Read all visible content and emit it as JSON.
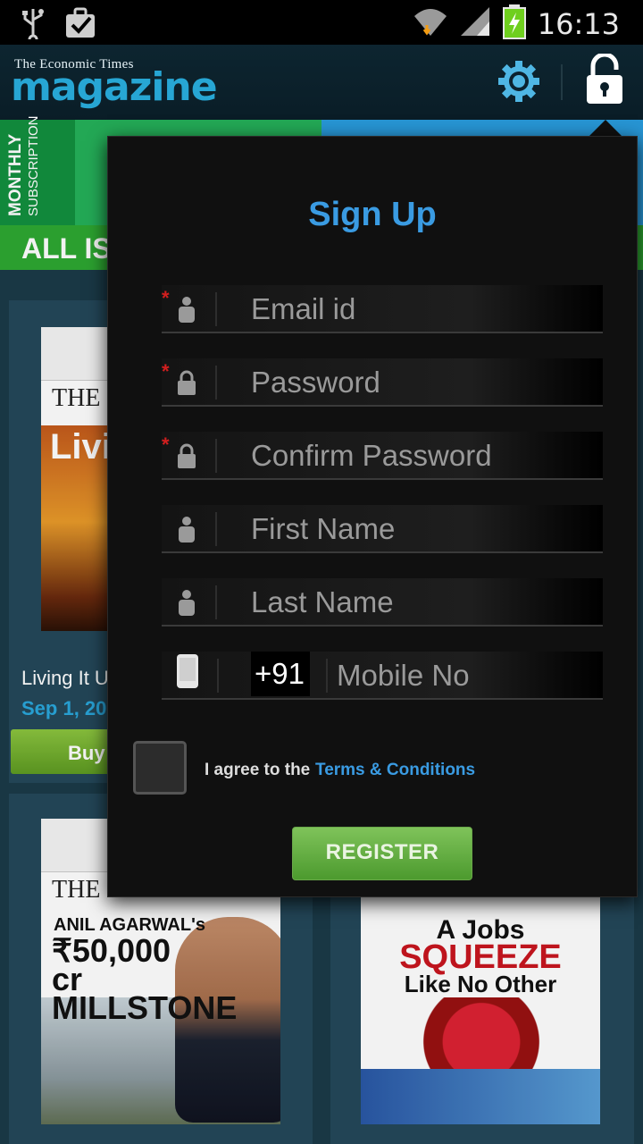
{
  "status_bar": {
    "time": "16:13",
    "icons": [
      "usb-icon",
      "checkbox-icon",
      "wifi-icon",
      "signal-icon",
      "battery-icon"
    ]
  },
  "header": {
    "logo_top": "The Economic Times",
    "logo_main": "magazine",
    "settings_icon": "gear-icon",
    "account_icon": "lock-icon"
  },
  "subscription": {
    "monthly_label": "MONTHLY",
    "monthly_sub": "SUBSCRIPTION"
  },
  "section": {
    "all_issues": "ALL IS"
  },
  "issues": [
    {
      "cover_brand": "THE E",
      "cover_headline": "Livi",
      "title": "Living It U",
      "date": "Sep 1, 20",
      "buy_label": "Buy"
    },
    {
      "cover_brand": "THE E",
      "cover_headline": "ANIL AGARWAL's",
      "cover_big": "₹50,000 cr MILLSTONE"
    },
    {
      "cover_headline_top": "A Jobs",
      "cover_headline_mid": "SQUEEZE",
      "cover_headline_bot": "Like No Other"
    }
  ],
  "signup": {
    "title": "Sign Up",
    "fields": {
      "email": {
        "placeholder": "Email id",
        "required": true,
        "icon": "person-icon"
      },
      "password": {
        "placeholder": "Password",
        "required": true,
        "icon": "lock-icon"
      },
      "confirm_password": {
        "placeholder": "Confirm Password",
        "required": true,
        "icon": "lock-icon"
      },
      "first_name": {
        "placeholder": "First Name",
        "required": false,
        "icon": "person-icon"
      },
      "last_name": {
        "placeholder": "Last Name",
        "required": false,
        "icon": "person-icon"
      },
      "mobile": {
        "placeholder": "Mobile No",
        "country_code": "+91",
        "icon": "phone-icon"
      }
    },
    "required_mark": "*",
    "agree_text": "I agree to the",
    "terms_link": "Terms & Conditions",
    "register_label": "REGISTER"
  },
  "colors": {
    "accent_blue": "#3a9be2",
    "register_green": "#5fae3e",
    "required_red": "#d21e1e"
  }
}
